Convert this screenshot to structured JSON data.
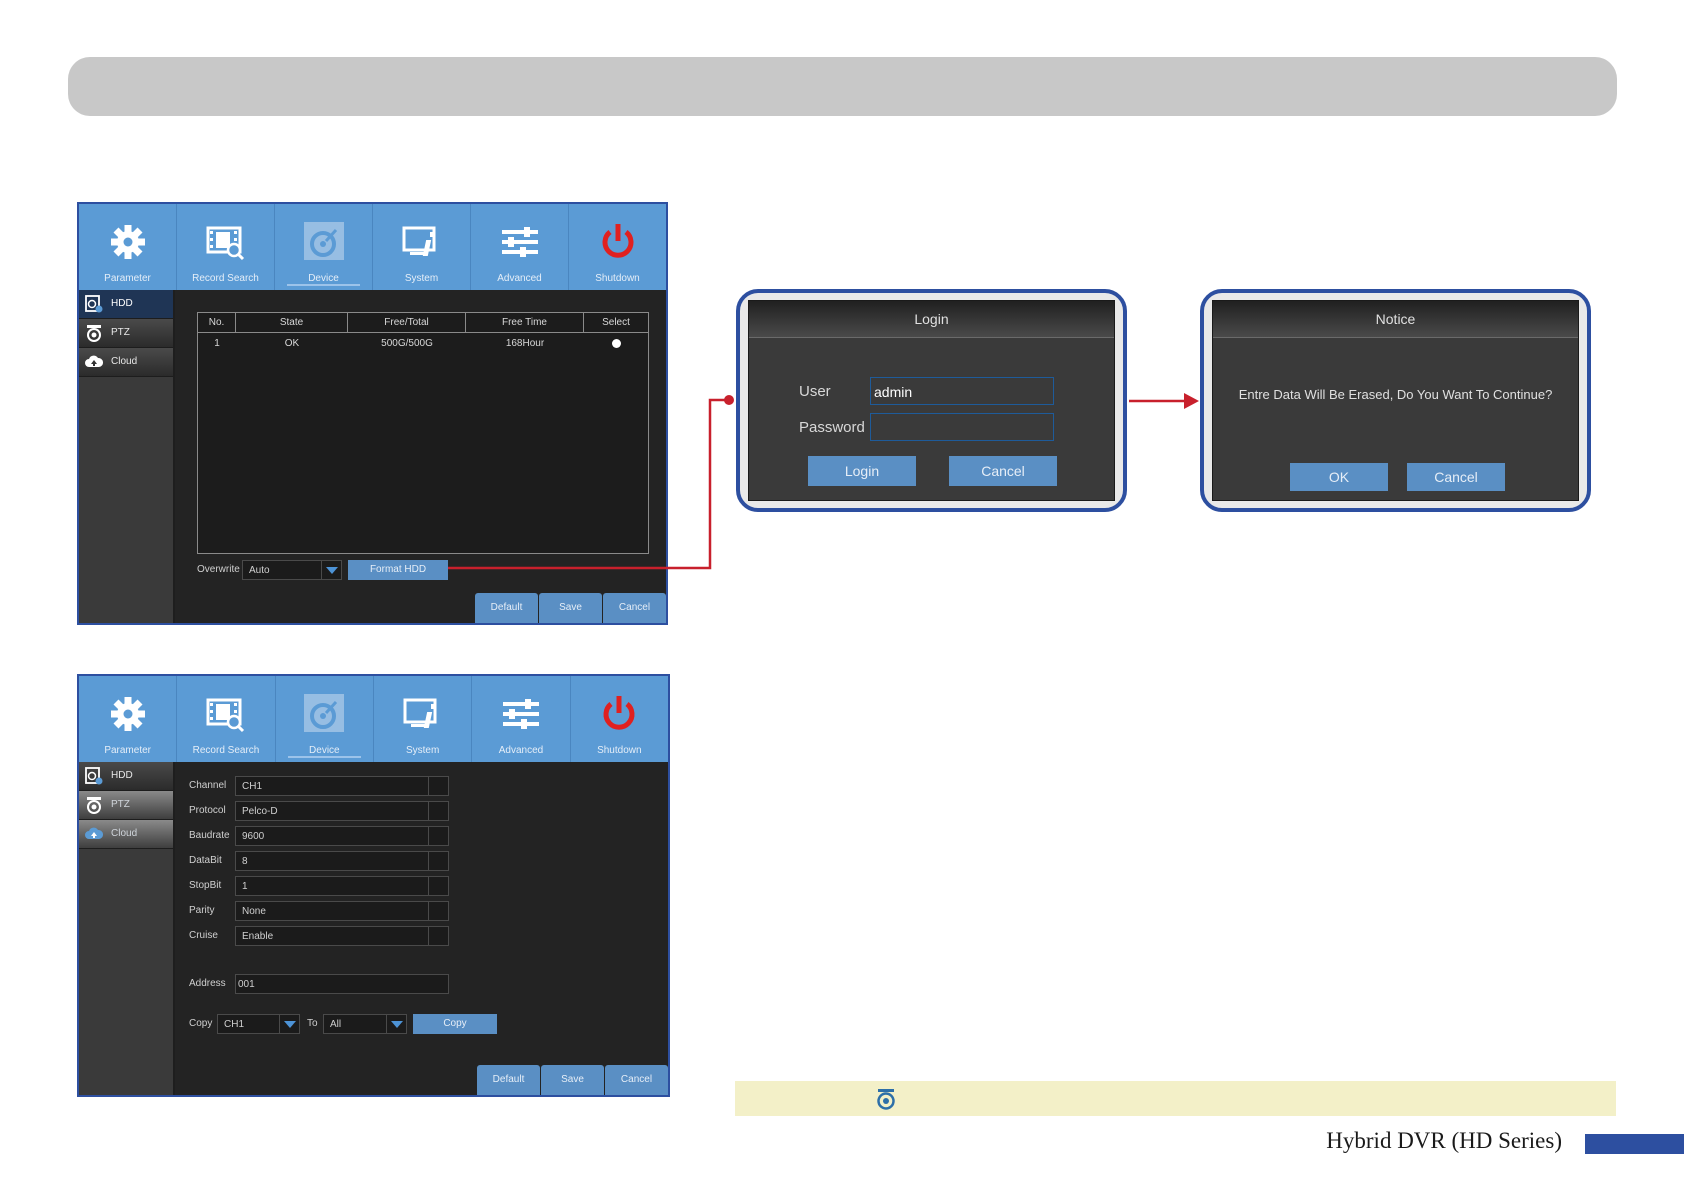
{
  "tabs": [
    {
      "key": "parameter",
      "label": "Parameter",
      "icon": "gear-icon"
    },
    {
      "key": "record-search",
      "label": "Record Search",
      "icon": "film-search-icon"
    },
    {
      "key": "device",
      "label": "Device",
      "icon": "device-icon"
    },
    {
      "key": "system",
      "label": "System",
      "icon": "system-info-icon"
    },
    {
      "key": "advanced",
      "label": "Advanced",
      "icon": "sliders-icon"
    },
    {
      "key": "shutdown",
      "label": "Shutdown",
      "icon": "power-icon"
    }
  ],
  "sidebar": [
    {
      "key": "hdd",
      "label": "HDD",
      "icon": "hdd-icon"
    },
    {
      "key": "ptz",
      "label": "PTZ",
      "icon": "ptz-camera-icon"
    },
    {
      "key": "cloud",
      "label": "Cloud",
      "icon": "cloud-icon"
    }
  ],
  "hdd_panel": {
    "columns": [
      "No.",
      "State",
      "Free/Total",
      "Free Time",
      "Select"
    ],
    "rows": [
      {
        "no": "1",
        "state": "OK",
        "free_total": "500G/500G",
        "free_time": "168Hour"
      }
    ],
    "overwrite_label": "Overwrite",
    "overwrite_value": "Auto",
    "format_button": "Format HDD"
  },
  "ptz_panel": {
    "fields": [
      {
        "label": "Channel",
        "value": "CH1"
      },
      {
        "label": "Protocol",
        "value": "Pelco-D"
      },
      {
        "label": "Baudrate",
        "value": "9600"
      },
      {
        "label": "DataBit",
        "value": "8"
      },
      {
        "label": "StopBit",
        "value": "1"
      },
      {
        "label": "Parity",
        "value": "None"
      },
      {
        "label": "Cruise",
        "value": "Enable"
      }
    ],
    "address_label": "Address",
    "address_value": "001",
    "copy_label": "Copy",
    "copy_from": "CH1",
    "to_label": "To",
    "copy_to": "All",
    "copy_button": "Copy"
  },
  "bottom_buttons": {
    "default": "Default",
    "save": "Save",
    "cancel": "Cancel"
  },
  "login_dialog": {
    "title": "Login",
    "user_label": "User",
    "user_value": "admin",
    "password_label": "Password",
    "password_value": "",
    "login_button": "Login",
    "cancel_button": "Cancel"
  },
  "notice_dialog": {
    "title": "Notice",
    "message": "Entre Data Will Be Erased, Do You Want To Continue?",
    "ok_button": "OK",
    "cancel_button": "Cancel"
  },
  "footer": {
    "title": "Hybrid DVR (HD Series)"
  },
  "colors": {
    "topbar": "#5b9bd5",
    "accent_button": "#5a8fc4",
    "dialog_border": "#2d4fa0",
    "connector": "#c8202c",
    "shutdown_icon": "#e02020",
    "note_band": "#f3f0c8"
  }
}
